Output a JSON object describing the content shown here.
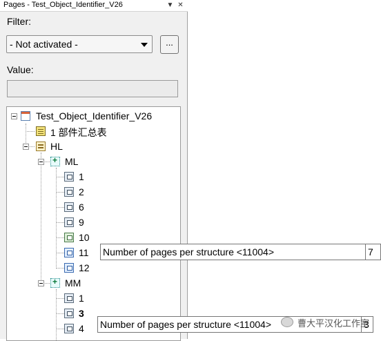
{
  "panel": {
    "title": "Pages - Test_Object_Identifier_V26",
    "filter_label": "Filter:",
    "filter_value": "- Not activated -",
    "more_button": "...",
    "value_label": "Value:",
    "value_text": ""
  },
  "tree": {
    "root": "Test_Object_Identifier_V26",
    "parts_list": "1 部件汇总表",
    "hl": "HL",
    "ml": "ML",
    "ml_pages": [
      "1",
      "2",
      "6",
      "9",
      "10",
      "11",
      "12"
    ],
    "mm": "MM",
    "mm_pages": [
      "1",
      "3",
      "4"
    ]
  },
  "tooltips": [
    {
      "text": "Number of pages per structure <11004>",
      "value": "7"
    },
    {
      "text": "Number of pages per structure <11004>",
      "value": "3"
    }
  ],
  "watermark": {
    "text": "曹大平汉化工作室"
  }
}
